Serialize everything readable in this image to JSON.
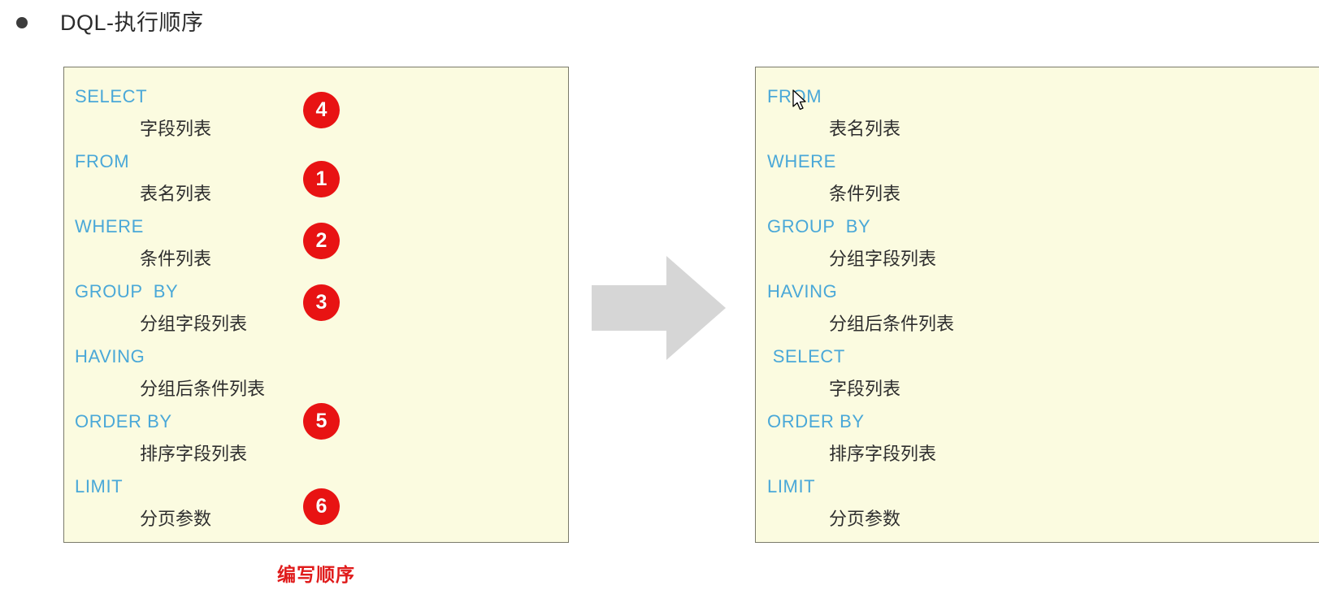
{
  "header": {
    "bullet_icon": "bullet-dot-icon",
    "title": "DQL-执行顺序"
  },
  "left_panel": {
    "caption": "编写顺序",
    "caption_color": "#e01b1b",
    "box_fill": "#fbfbe0",
    "keyword_color": "#4aa8d8",
    "value_color": "#2e2e2e",
    "lines": [
      {
        "keyword": "SELECT",
        "value": "字段列表"
      },
      {
        "keyword": "FROM",
        "value": "表名列表"
      },
      {
        "keyword": "WHERE",
        "value": "条件列表"
      },
      {
        "keyword": "GROUP  BY",
        "value": "分组字段列表"
      },
      {
        "keyword": "HAVING",
        "value": "分组后条件列表"
      },
      {
        "keyword": "ORDER BY",
        "value": "排序字段列表"
      },
      {
        "keyword": "LIMIT",
        "value": "分页参数"
      }
    ],
    "badges": [
      {
        "label": "4",
        "for_keyword": "SELECT"
      },
      {
        "label": "1",
        "for_keyword": "FROM"
      },
      {
        "label": "2",
        "for_keyword": "WHERE"
      },
      {
        "label": "3",
        "for_keyword": "GROUP  BY"
      },
      {
        "label": "5",
        "for_keyword": "ORDER BY"
      },
      {
        "label": "6",
        "for_keyword": "LIMIT"
      }
    ],
    "badge_color": "#e81313"
  },
  "arrow": {
    "icon": "right-arrow-icon",
    "color": "#d6d6d6",
    "direction": "right"
  },
  "right_panel": {
    "box_fill": "#fbfbe0",
    "keyword_color": "#4aa8d8",
    "value_color": "#2e2e2e",
    "lines": [
      {
        "keyword": "FROM",
        "value": "表名列表"
      },
      {
        "keyword": "WHERE",
        "value": "条件列表"
      },
      {
        "keyword": "GROUP  BY",
        "value": "分组字段列表"
      },
      {
        "keyword": "HAVING",
        "value": "分组后条件列表"
      },
      {
        "keyword": " SELECT",
        "value": "字段列表"
      },
      {
        "keyword": "ORDER BY",
        "value": "排序字段列表"
      },
      {
        "keyword": "LIMIT",
        "value": "分页参数"
      }
    ]
  },
  "cursor": {
    "icon": "mouse-pointer-icon"
  }
}
